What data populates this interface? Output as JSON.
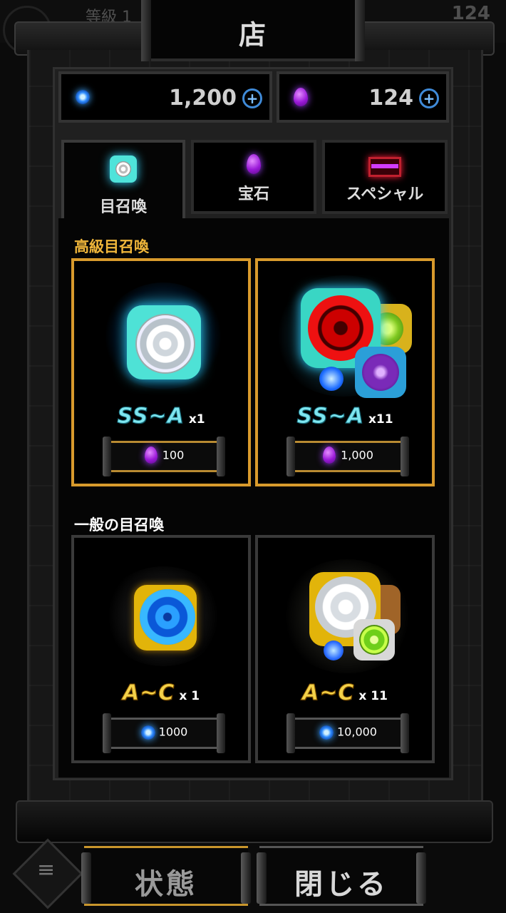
{
  "window": {
    "title": "店"
  },
  "background_hud": {
    "rank_text": "等級 1",
    "right_number": "124"
  },
  "currencies": [
    {
      "type": "blue-orb",
      "amount": "1,200"
    },
    {
      "type": "purple-magatama",
      "amount": "124"
    }
  ],
  "tabs": [
    {
      "label": "目召喚",
      "icon": "eye-summon-icon",
      "active": true
    },
    {
      "label": "宝石",
      "icon": "gem-icon",
      "active": false
    },
    {
      "label": "スペシャル",
      "icon": "treasure-chest-icon",
      "active": false
    }
  ],
  "sections": {
    "premium": {
      "title": "高級目召喚",
      "title_color": "#f0b63a",
      "cards": [
        {
          "rank": "SS~A",
          "count": "x1",
          "price": "100",
          "currency": "purple-magatama"
        },
        {
          "rank": "SS~A",
          "count": "x11",
          "price": "1,000",
          "currency": "purple-magatama"
        }
      ]
    },
    "normal": {
      "title": "一般の目召喚",
      "title_color": "#ffffff",
      "cards": [
        {
          "rank": "A~C",
          "count": "x 1",
          "price": "1000",
          "currency": "blue-orb"
        },
        {
          "rank": "A~C",
          "count": "x 11",
          "price": "10,000",
          "currency": "blue-orb"
        }
      ]
    }
  },
  "buttons": {
    "status_label": "状態",
    "close_label": "閉じる"
  },
  "colors": {
    "gold_border": "#d89a2c",
    "accent_blue": "#3f8ad8",
    "purple": "#a040ff"
  }
}
